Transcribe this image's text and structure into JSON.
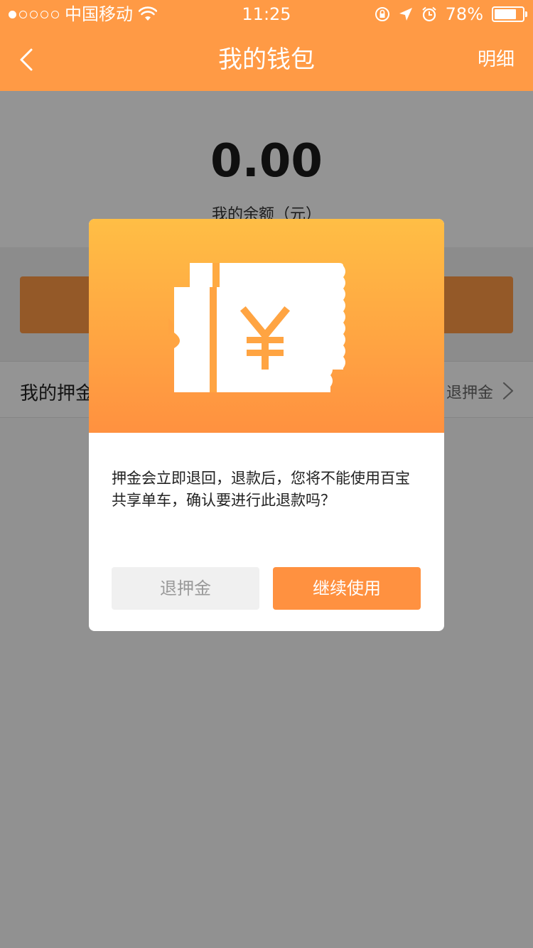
{
  "status_bar": {
    "carrier": "中国移动",
    "time": "11:25",
    "battery": "78%",
    "battery_level": 0.78
  },
  "nav": {
    "title": "我的钱包",
    "detail": "明细"
  },
  "wallet": {
    "balance": "0.00",
    "balance_label": "我的余额（元）",
    "deposit_label": "我的押金",
    "deposit_refund": "退押金"
  },
  "dialog": {
    "icon": "yuan-ticket-icon",
    "message": "押金会立即退回，退款后，您将不能使用百宝共享单车，确认要进行此退款吗？",
    "refund_button": "退押金",
    "continue_button": "继续使用"
  },
  "colors": {
    "brand_orange": "#ff9a45",
    "dialog_gradient_top": "#ffbe45",
    "dialog_gradient_bottom": "#ff9140",
    "secondary_button": "#f0f0f0"
  }
}
